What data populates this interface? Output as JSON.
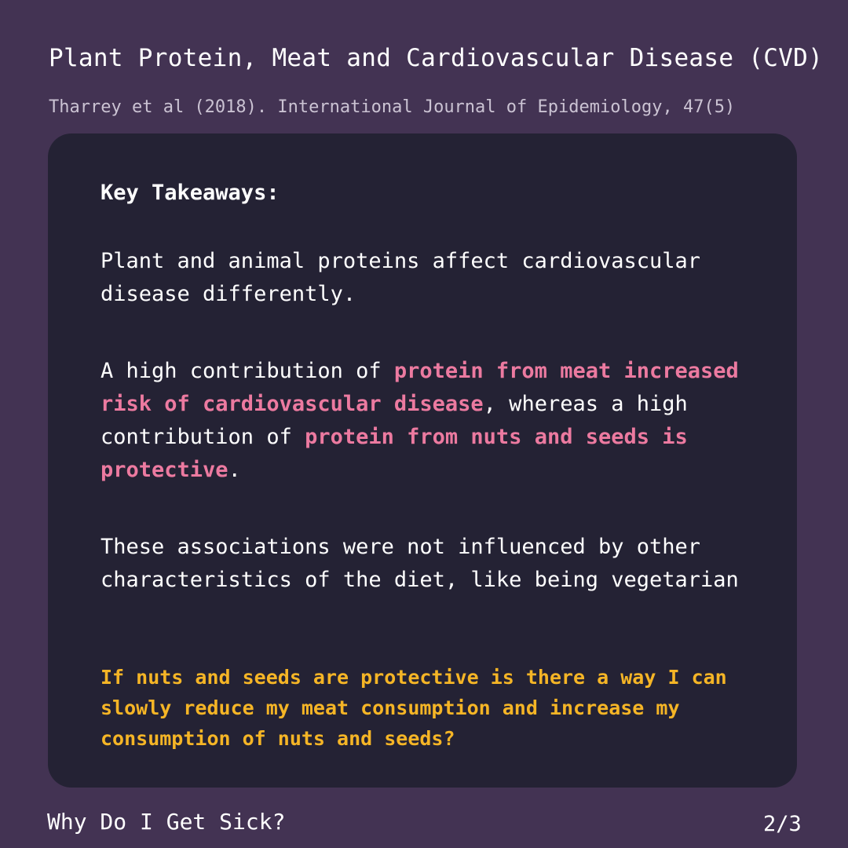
{
  "header": {
    "title": "Plant Protein, Meat and Cardiovascular Disease (CVD)",
    "citation": "Tharrey et al (2018). International Journal of Epidemiology, 47(5)"
  },
  "card": {
    "heading": "Key Takeaways:",
    "para1": "Plant and animal proteins affect cardiovascular disease differently.",
    "para2": {
      "t1": "A high contribution of ",
      "h1": "protein from meat increased risk of cardiovascular disease",
      "t2": ", whereas a high contribution of ",
      "h2": "protein from nuts and seeds is protective",
      "t3": "."
    },
    "para3": "These associations were not influenced by other characteristics of the diet, like being vegetarian",
    "question": "If nuts and seeds are protective is there a way I can slowly reduce my meat consumption and increase my consumption of nuts and seeds?"
  },
  "footer": {
    "brand": "Why Do I Get Sick?",
    "page": "2/3"
  },
  "colors": {
    "background": "#433353",
    "card": "#242234",
    "highlight": "#ec7aa0",
    "question": "#f5b526"
  }
}
